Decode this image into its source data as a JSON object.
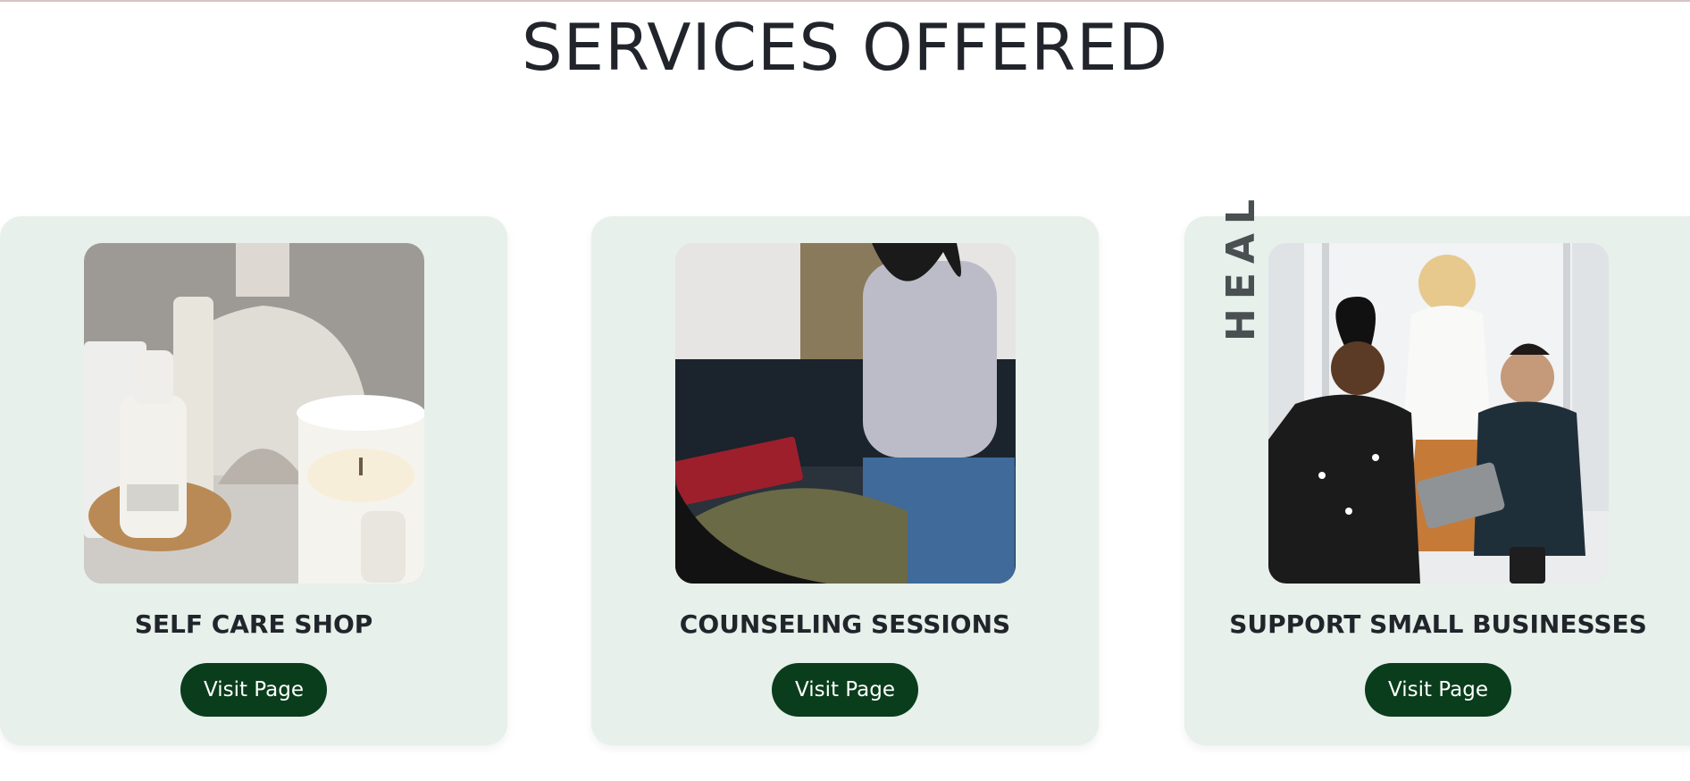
{
  "section": {
    "title": "SERVICES OFFERED"
  },
  "cards": [
    {
      "title": "SELF CARE SHOP",
      "button_label": "Visit Page",
      "image_alt": "Skincare products and candle"
    },
    {
      "title": "COUNSELING SESSIONS",
      "button_label": "Visit Page",
      "image_alt": "Counseling session"
    },
    {
      "title": "SUPPORT SMALL BUSINESSES",
      "button_label": "Visit Page",
      "image_alt": "Small business team",
      "image_overlay_text": "HEAL"
    }
  ],
  "colors": {
    "card_bg": "#e7f0ea",
    "button_bg": "#0a3d1c",
    "button_text": "#ffffff",
    "heading": "#21252b"
  }
}
